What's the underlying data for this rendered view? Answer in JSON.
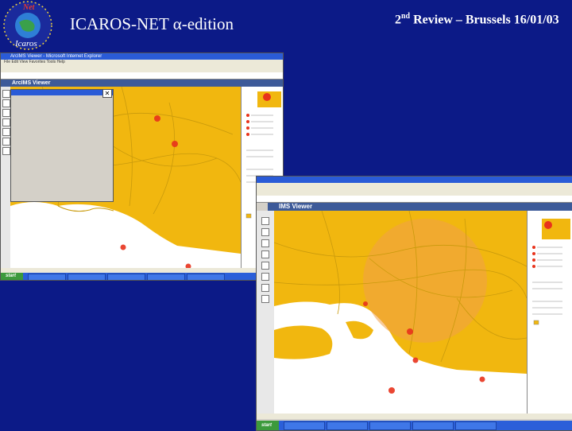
{
  "slide": {
    "title": "ICAROS-NET α-edition",
    "review_prefix": "2",
    "review_sup": "nd",
    "review_rest": " Review – Brussels 16/01/03",
    "logo_text_top": "Net",
    "logo_text_bottom": "Icaros"
  },
  "screenshot1": {
    "browser_title": "ArcIMS Viewer - Microsoft Internet Explorer",
    "menu": "File  Edit  View  Favorites  Tools  Help",
    "viewer_banner": "ArcIMS Viewer",
    "start_label": "start"
  },
  "screenshot2": {
    "viewer_banner": "IMS Viewer",
    "start_label": "start"
  },
  "colors": {
    "background": "#0c1a87",
    "map": "#f1b70f",
    "sea": "#ffffff",
    "hotspot": "#e8331c"
  }
}
